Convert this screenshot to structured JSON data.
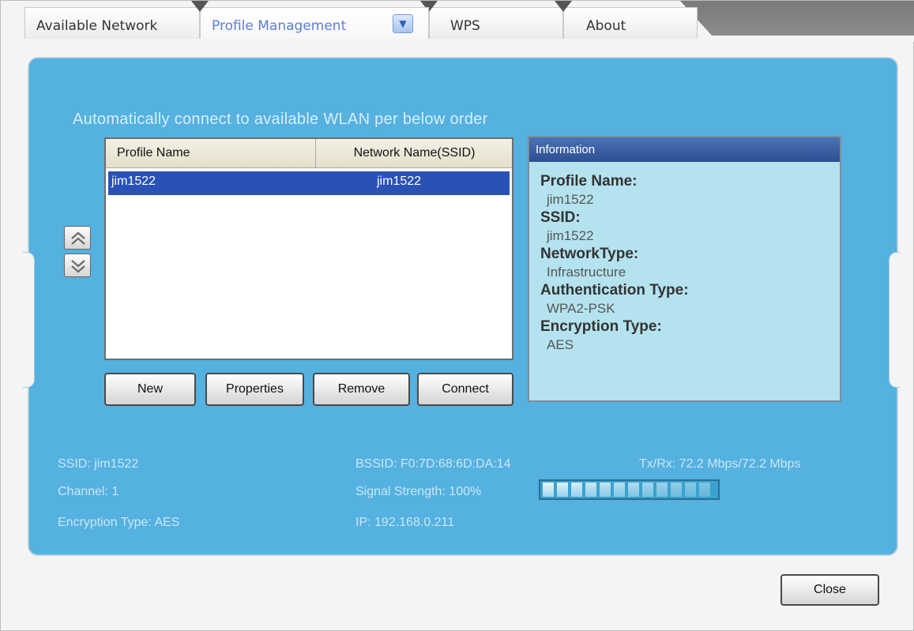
{
  "tabs": {
    "available_network": "Available Network",
    "profile_management": "Profile Management",
    "wps": "WPS",
    "about": "About"
  },
  "headline": "Automatically connect to available WLAN per below order",
  "profile_list": {
    "columns": [
      "Profile Name",
      "Network Name(SSID)"
    ],
    "rows": [
      {
        "profile_name": "jim1522",
        "ssid": "jim1522"
      }
    ]
  },
  "buttons": {
    "new": "New",
    "properties": "Properties",
    "remove": "Remove",
    "connect": "Connect",
    "close": "Close"
  },
  "info": {
    "title": "Information",
    "profile_name_label": "Profile Name:",
    "profile_name": "jim1522",
    "ssid_label": "SSID:",
    "ssid": "jim1522",
    "network_type_label": "NetworkType:",
    "network_type": "Infrastructure",
    "auth_type_label": "Authentication Type:",
    "auth_type": "WPA2-PSK",
    "encryption_type_label": "Encryption Type:",
    "encryption_type": "AES"
  },
  "status": {
    "ssid": "SSID: jim1522",
    "channel": "Channel: 1",
    "encryption": "Encryption Type: AES",
    "bssid": "BSSID: F0:7D:68:6D:DA:14",
    "signal_text": "Signal Strength: 100%",
    "signal_strength": 1.0,
    "ip": "IP: 192.168.0.211",
    "txrx": "Tx/Rx: 72.2 Mbps/72.2 Mbps"
  },
  "icons": {
    "move_up": "double-chevron-up-icon",
    "move_down": "double-chevron-down-icon",
    "tab_dropdown": "dropdown-arrow-icon"
  },
  "colors": {
    "panel": "#55b1df",
    "selection": "#2a52b6",
    "info_header": "#2d4f92",
    "active_tab_text": "#5b7fd6"
  }
}
